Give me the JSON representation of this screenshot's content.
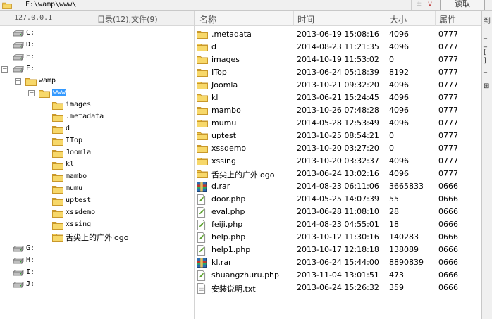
{
  "path_bar": {
    "path": "F:\\wamp\\www\\",
    "dropdown_mark": "±",
    "dropdown_arrow": "∨",
    "read_button": "读取"
  },
  "left_pane": {
    "host": "127.0.0.1",
    "dir_count": "目录(12),文件(9)",
    "drives_top": [
      "C:",
      "D:",
      "E:"
    ],
    "drive_f": "F:",
    "wamp": "wamp",
    "www": "www",
    "www_children": [
      "images",
      ".metadata",
      "d",
      "ITop",
      "Joomla",
      "kl",
      "mambo",
      "mumu",
      "uptest",
      "xssdemo",
      "xssing",
      "舌尖上的广外logo"
    ],
    "drives_bottom": [
      "G:",
      "H:",
      "I:",
      "J:"
    ]
  },
  "list_header": {
    "name": "名称",
    "time": "时间",
    "size": "大小",
    "perm": "属性"
  },
  "files": [
    {
      "type": "folder",
      "name": ".metadata",
      "time": "2013-06-19 15:08:16",
      "size": "4096",
      "perm": "0777"
    },
    {
      "type": "folder",
      "name": "d",
      "time": "2014-08-23 11:21:35",
      "size": "4096",
      "perm": "0777"
    },
    {
      "type": "folder",
      "name": "images",
      "time": "2014-10-19 11:53:02",
      "size": "0",
      "perm": "0777"
    },
    {
      "type": "folder",
      "name": "ITop",
      "time": "2013-06-24 05:18:39",
      "size": "8192",
      "perm": "0777"
    },
    {
      "type": "folder",
      "name": "Joomla",
      "time": "2013-10-21 09:32:20",
      "size": "4096",
      "perm": "0777"
    },
    {
      "type": "folder",
      "name": "kl",
      "time": "2013-06-21 15:24:45",
      "size": "4096",
      "perm": "0777"
    },
    {
      "type": "folder",
      "name": "mambo",
      "time": "2013-10-26 07:48:28",
      "size": "4096",
      "perm": "0777"
    },
    {
      "type": "folder",
      "name": "mumu",
      "time": "2014-05-28 12:53:49",
      "size": "4096",
      "perm": "0777"
    },
    {
      "type": "folder",
      "name": "uptest",
      "time": "2013-10-25 08:54:21",
      "size": "0",
      "perm": "0777"
    },
    {
      "type": "folder",
      "name": "xssdemo",
      "time": "2013-10-20 03:27:20",
      "size": "0",
      "perm": "0777"
    },
    {
      "type": "folder",
      "name": "xssing",
      "time": "2013-10-20 03:32:37",
      "size": "4096",
      "perm": "0777"
    },
    {
      "type": "folder",
      "name": "舌尖上的广外logo",
      "time": "2013-06-24 13:02:16",
      "size": "4096",
      "perm": "0777"
    },
    {
      "type": "archive",
      "name": "d.rar",
      "time": "2014-08-23 06:11:06",
      "size": "3665833",
      "perm": "0666"
    },
    {
      "type": "php",
      "name": "door.php",
      "time": "2014-05-25 14:07:39",
      "size": "55",
      "perm": "0666"
    },
    {
      "type": "php",
      "name": "eval.php",
      "time": "2013-06-28 11:08:10",
      "size": "28",
      "perm": "0666"
    },
    {
      "type": "php",
      "name": "feiji.php",
      "time": "2014-08-23 04:55:01",
      "size": "18",
      "perm": "0666"
    },
    {
      "type": "php",
      "name": "help.php",
      "time": "2013-10-12 11:30:16",
      "size": "140283",
      "perm": "0666"
    },
    {
      "type": "php",
      "name": "help1.php",
      "time": "2013-10-17 12:18:18",
      "size": "138089",
      "perm": "0666"
    },
    {
      "type": "archive",
      "name": "kl.rar",
      "time": "2013-06-24 15:44:00",
      "size": "8890839",
      "perm": "0666"
    },
    {
      "type": "php",
      "name": "shuangzhuru.php",
      "time": "2013-11-04 13:01:51",
      "size": "473",
      "perm": "0666"
    },
    {
      "type": "text",
      "name": "安装说明.txt",
      "time": "2013-06-24 15:26:32",
      "size": "359",
      "perm": "0666"
    }
  ],
  "colors": {
    "folder": "#f2c94c",
    "selection": "#3399ff",
    "php": "#5aa02c",
    "archive": "#2b6cb0"
  },
  "side_strip_chars": [
    "到",
    "_",
    "_",
    "[",
    "]",
    "_",
    "⊞"
  ]
}
